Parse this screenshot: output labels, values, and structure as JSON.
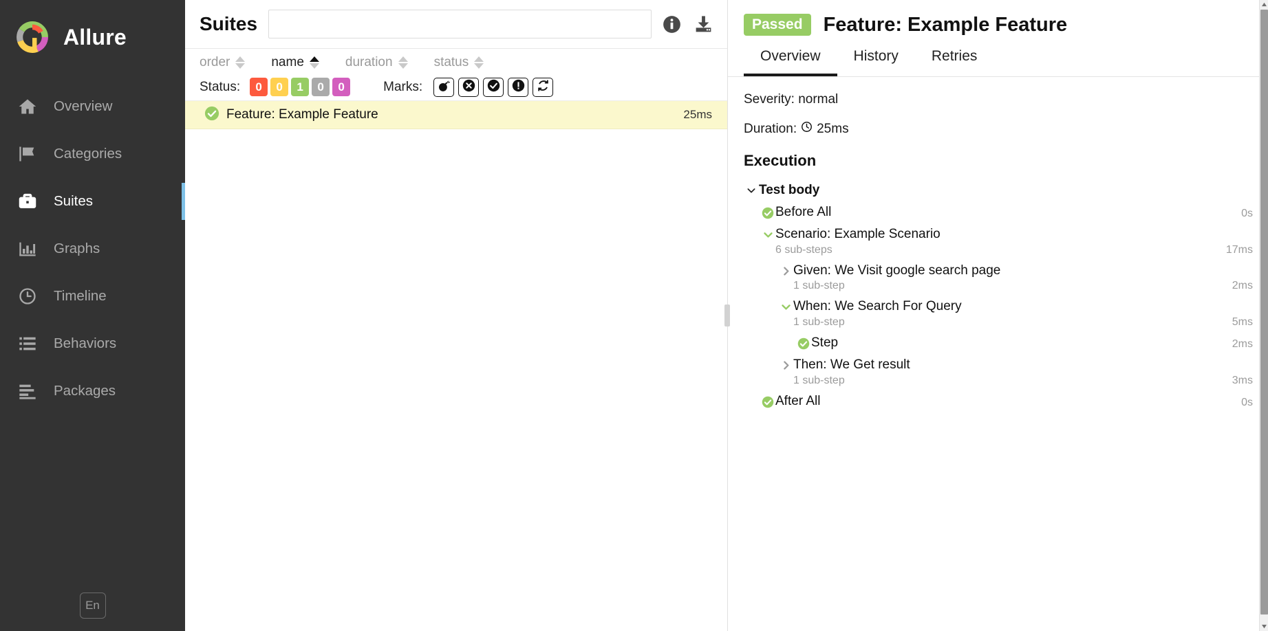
{
  "app": {
    "brand": "Allure",
    "logo_colors": {
      "green": "#97cc64",
      "red": "#fd5a3e",
      "magenta": "#d35ebe",
      "yellow": "#ffd050",
      "gray": "#aaaaaa"
    },
    "accent": "#7ec1e7"
  },
  "sidebar": {
    "items": [
      {
        "label": "Overview",
        "icon": "home-icon",
        "active": false
      },
      {
        "label": "Categories",
        "icon": "flag-icon",
        "active": false
      },
      {
        "label": "Suites",
        "icon": "briefcase-icon",
        "active": true
      },
      {
        "label": "Graphs",
        "icon": "bar-chart-icon",
        "active": false
      },
      {
        "label": "Timeline",
        "icon": "clock-icon",
        "active": false
      },
      {
        "label": "Behaviors",
        "icon": "list-icon",
        "active": false
      },
      {
        "label": "Packages",
        "icon": "packages-icon",
        "active": false
      }
    ],
    "language_button": "En"
  },
  "middle": {
    "title": "Suites",
    "search": {
      "value": "",
      "placeholder": ""
    },
    "header_icons": [
      {
        "name": "info-icon"
      },
      {
        "name": "download-icon"
      }
    ],
    "sorters": [
      {
        "label": "order",
        "active": false
      },
      {
        "label": "name",
        "active": true
      },
      {
        "label": "duration",
        "active": false
      },
      {
        "label": "status",
        "active": false
      }
    ],
    "status_filter": {
      "label": "Status:",
      "chips": [
        {
          "count": "0",
          "color": "#fd5a3e",
          "status": "failed"
        },
        {
          "count": "0",
          "color": "#ffd050",
          "status": "broken"
        },
        {
          "count": "1",
          "color": "#97cc64",
          "status": "passed"
        },
        {
          "count": "0",
          "color": "#aaaaaa",
          "status": "skipped"
        },
        {
          "count": "0",
          "color": "#d35ebe",
          "status": "unknown"
        }
      ]
    },
    "marks_filter": {
      "label": "Marks:",
      "marks": [
        {
          "name": "bomb-icon",
          "title": "flaky"
        },
        {
          "name": "x-circle-icon",
          "title": "failed"
        },
        {
          "name": "check-circle-icon",
          "title": "passed"
        },
        {
          "name": "alert-circle-icon",
          "title": "unstable"
        },
        {
          "name": "refresh-icon",
          "title": "retries"
        }
      ]
    },
    "rows": [
      {
        "name": "Feature: Example Feature",
        "duration": "25ms",
        "status": "passed",
        "selected": true
      }
    ]
  },
  "right": {
    "status_badge": "Passed",
    "title": "Feature: Example Feature",
    "tabs": [
      {
        "label": "Overview",
        "active": true
      },
      {
        "label": "History",
        "active": false
      },
      {
        "label": "Retries",
        "active": false
      }
    ],
    "severity_line": "Severity: normal",
    "duration_label": "Duration:",
    "duration_value": "25ms",
    "execution_title": "Execution",
    "steps": [
      {
        "name": "Test body",
        "marker": "chevron-down-dark",
        "sub": "",
        "time": "",
        "indent": 0,
        "bold": true
      },
      {
        "name": "Before All",
        "marker": "check-circle",
        "sub": "",
        "time": "0s",
        "indent": 1,
        "bold": false
      },
      {
        "name": "Scenario: Example Scenario",
        "marker": "chevron-down-green",
        "sub": "6 sub-steps",
        "time": "17ms",
        "indent": 1,
        "bold": false
      },
      {
        "name": "Given: We Visit google search page",
        "marker": "chevron-right-gray",
        "sub": "1 sub-step",
        "time": "2ms",
        "indent": 2,
        "bold": false
      },
      {
        "name": "When: We Search For Query",
        "marker": "chevron-down-green",
        "sub": "1 sub-step",
        "time": "5ms",
        "indent": 2,
        "bold": false
      },
      {
        "name": "Step",
        "marker": "check-circle",
        "sub": "",
        "time": "2ms",
        "indent": 3,
        "bold": false
      },
      {
        "name": "Then: We Get result",
        "marker": "chevron-right-gray",
        "sub": "1 sub-step",
        "time": "3ms",
        "indent": 2,
        "bold": false
      },
      {
        "name": "After All",
        "marker": "check-circle",
        "sub": "",
        "time": "0s",
        "indent": 1,
        "bold": false
      }
    ]
  }
}
